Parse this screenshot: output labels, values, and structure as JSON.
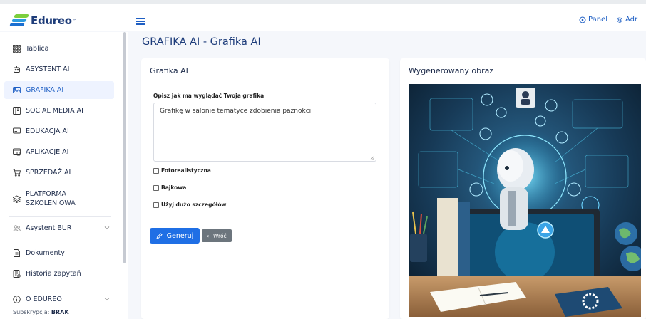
{
  "brand": {
    "name": "Edureo",
    "tm": "™"
  },
  "topbar": {
    "panel": "Panel",
    "admin": "Adr"
  },
  "sidebar": {
    "items": [
      {
        "label": "Tablica",
        "icon": "grid-icon"
      },
      {
        "label": "ASYSTENT AI",
        "icon": "robot-icon"
      },
      {
        "label": "GRAFIKA AI",
        "icon": "image-icon"
      },
      {
        "label": "SOCIAL MEDIA AI",
        "icon": "social-icon"
      },
      {
        "label": "EDUKACJA AI",
        "icon": "education-icon"
      },
      {
        "label": "APLIKACJE AI",
        "icon": "apps-icon"
      },
      {
        "label": "SPRZEDAŻ AI",
        "icon": "cart-icon"
      },
      {
        "label": "PLATFORMA\nSZKOLENIOWA",
        "icon": "layers-icon"
      },
      {
        "label": "Asystent BUR",
        "icon": "users-icon"
      },
      {
        "label": "Dokumenty",
        "icon": "document-icon"
      },
      {
        "label": "Historia zapytań",
        "icon": "history-icon"
      },
      {
        "label": "O EDUREO",
        "icon": "info-icon"
      }
    ],
    "active_index": 2,
    "subscription_label": "Subskrypcja:",
    "subscription_value": "BRAK"
  },
  "page": {
    "title": "GRAFIKA AI - Grafika AI"
  },
  "form": {
    "card_title": "Grafika AI",
    "prompt_label": "Opisz jak ma wyglądać Twoja grafika",
    "prompt_value": "Grafikę w salonie  tematyce zdobienia paznokci",
    "checkboxes": [
      {
        "label": "Fotorealistyczna",
        "checked": false
      },
      {
        "label": "Bajkowa",
        "checked": false
      },
      {
        "label": "Użyj dużo szczegółów",
        "checked": false
      }
    ],
    "generate_label": "Generuj",
    "back_label": "← Wróć"
  },
  "result": {
    "card_title": "Wygenerowany obraz"
  },
  "colors": {
    "primary": "#1f6fe5",
    "title": "#1d3c7a",
    "secondary_btn": "#6c757d"
  }
}
